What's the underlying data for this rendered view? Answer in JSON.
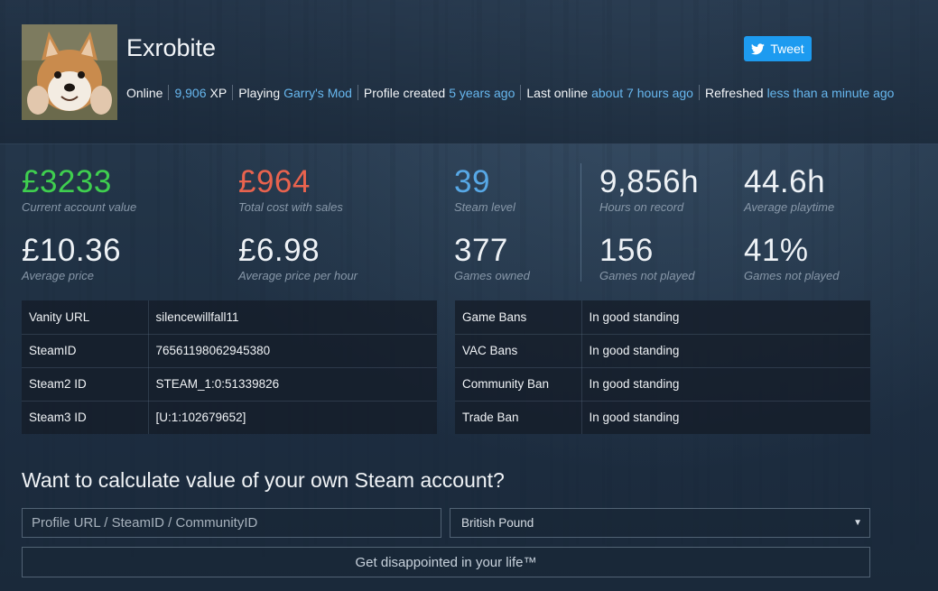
{
  "header": {
    "username": "Exrobite",
    "status": {
      "online": "Online",
      "xp_value": "9,906",
      "xp_label": "XP",
      "playing_label": "Playing",
      "playing_game": "Garry's Mod",
      "created_label": "Profile created",
      "created_value": "5 years ago",
      "last_online_label": "Last online",
      "last_online_value": "about 7 hours ago",
      "refreshed_label": "Refreshed",
      "refreshed_value": "less than a minute ago"
    },
    "tweet_label": "Tweet"
  },
  "stats": {
    "account_value": {
      "value": "£3233",
      "label": "Current account value"
    },
    "total_cost": {
      "value": "£964",
      "label": "Total cost with sales"
    },
    "steam_level": {
      "value": "39",
      "label": "Steam level"
    },
    "hours_on_record": {
      "value": "9,856h",
      "label": "Hours on record"
    },
    "average_playtime": {
      "value": "44.6h",
      "label": "Average playtime"
    },
    "average_price": {
      "value": "£10.36",
      "label": "Average price"
    },
    "average_price_per_hour": {
      "value": "£6.98",
      "label": "Average price per hour"
    },
    "games_owned": {
      "value": "377",
      "label": "Games owned"
    },
    "games_not_played_count": {
      "value": "156",
      "label": "Games not played"
    },
    "games_not_played_pct": {
      "value": "41%",
      "label": "Games not played"
    }
  },
  "profile_table": [
    {
      "key": "Vanity URL",
      "value": "silencewillfall11"
    },
    {
      "key": "SteamID",
      "value": "76561198062945380"
    },
    {
      "key": "Steam2 ID",
      "value": "STEAM_1:0:51339826"
    },
    {
      "key": "Steam3 ID",
      "value": "[U:1:102679652]"
    }
  ],
  "ban_table": [
    {
      "key": "Game Bans",
      "value": "In good standing"
    },
    {
      "key": "VAC Bans",
      "value": "In good standing"
    },
    {
      "key": "Community Ban",
      "value": "In good standing"
    },
    {
      "key": "Trade Ban",
      "value": "In good standing"
    }
  ],
  "calculator": {
    "title": "Want to calculate value of your own Steam account?",
    "input_placeholder": "Profile URL / SteamID / CommunityID",
    "currency_selected": "British Pound",
    "submit_label": "Get disappointed in your life™"
  },
  "colors": {
    "accent_link": "#67b7ee",
    "green": "#3fcf4f",
    "red": "#e9634e",
    "blue": "#57a8e6",
    "twitter": "#1d9bf0"
  }
}
